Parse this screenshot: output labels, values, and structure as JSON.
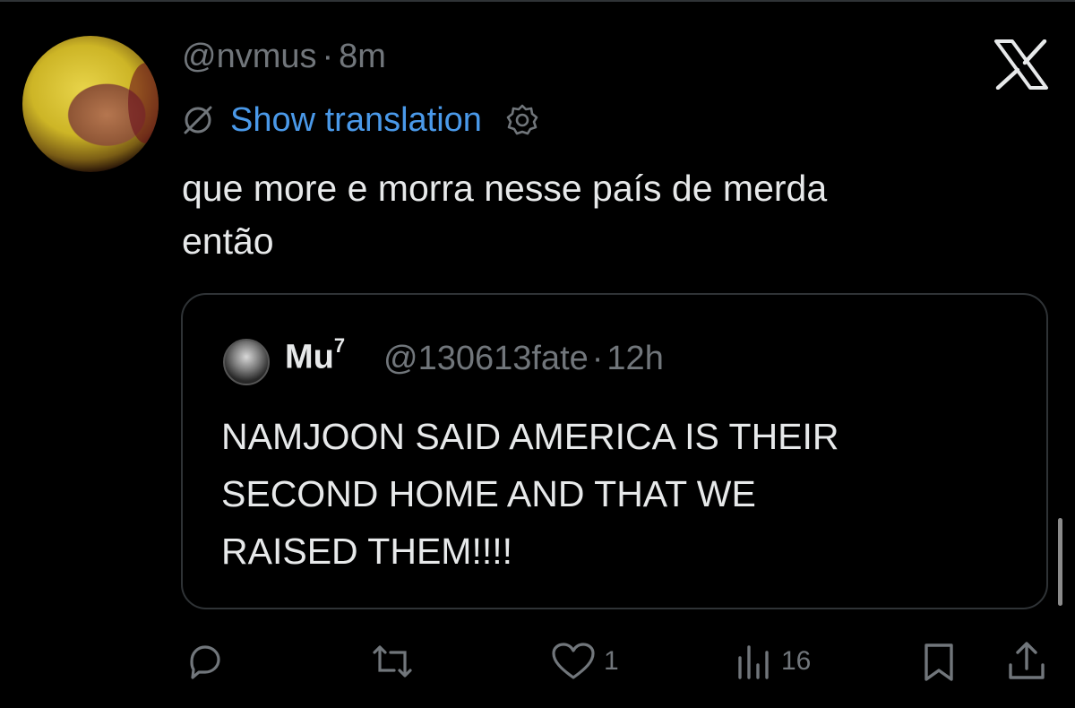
{
  "post": {
    "handle": "@nvmus",
    "separator": "·",
    "time": "8m",
    "translate_link": "Show translation",
    "text_line1": "que more e morra nesse país de merda",
    "text_line2": "então"
  },
  "quote": {
    "name": "Mu",
    "name_sup": "7",
    "handle": "@130613fate",
    "separator": "·",
    "time": "12h",
    "text_line1": "NAMJOON SAID AMERICA IS THEIR",
    "text_line2": "SECOND HOME AND THAT WE",
    "text_line3": "RAISED THEM!!!!"
  },
  "actions": {
    "likes": "1",
    "views": "16"
  },
  "icons": {
    "close": "x-logo-icon",
    "translate": "globe-slash-icon",
    "settings": "gear-icon",
    "reply": "reply-bubble-icon",
    "repost": "repost-icon",
    "like": "heart-icon",
    "views": "analytics-bars-icon",
    "bookmark": "bookmark-icon",
    "share": "share-icon"
  },
  "colors": {
    "background": "#000000",
    "text": "#e7e9ea",
    "muted": "#71767b",
    "link": "#4a99e9",
    "border": "#2f3336"
  }
}
